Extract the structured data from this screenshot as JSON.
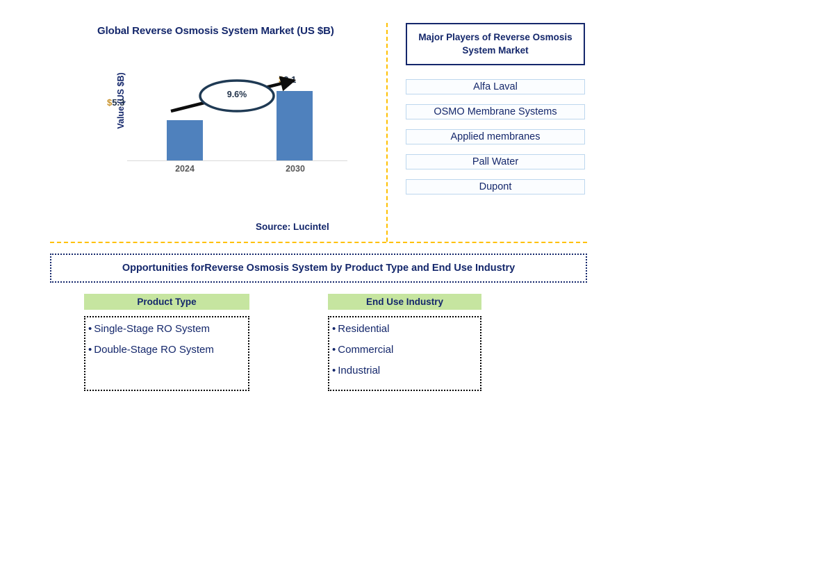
{
  "chart_data": {
    "type": "bar",
    "title": "Global Reverse Osmosis System Market (US $B)",
    "xlabel": "",
    "ylabel": "Value (US $B)",
    "categories": [
      "2024",
      "2030"
    ],
    "values": [
      5.3,
      9.1
    ],
    "value_labels": [
      "$5.3",
      "$9.1"
    ],
    "currency_symbol": "$",
    "value_numbers": [
      "5.3",
      "9.1"
    ],
    "annotation": "9.6%",
    "annotation_type": "CAGR growth arrow with ellipse",
    "ylim": [
      0,
      11
    ],
    "grid": false,
    "legend": false,
    "bar_color": "#4F81BD",
    "axis_label_color": "#595959"
  },
  "chart": {
    "title": "Global Reverse Osmosis System Market (US $B)",
    "y_axis_label": "Value (US $B)",
    "growth_label": "9.6%",
    "source": "Source: Lucintel"
  },
  "players": {
    "header": "Major Players of Reverse Osmosis System Market",
    "items": [
      "Alfa Laval",
      "OSMO Membrane Systems",
      "Applied membranes",
      "Pall Water",
      "Dupont"
    ]
  },
  "opportunities": {
    "banner": "Opportunities forReverse Osmosis System by Product Type and End Use Industry",
    "segments": [
      {
        "header": "Product Type",
        "items": [
          "Single-Stage RO System",
          "Double-Stage RO System"
        ]
      },
      {
        "header": "End Use Industry",
        "items": [
          "Residential",
          "Commercial",
          "Industrial"
        ]
      }
    ]
  },
  "colors": {
    "navy": "#14276B",
    "bar_blue": "#4F81BD",
    "divider_gold": "#FFC000",
    "segment_green": "#C6E5A0",
    "player_border": "#BDD7EE"
  }
}
